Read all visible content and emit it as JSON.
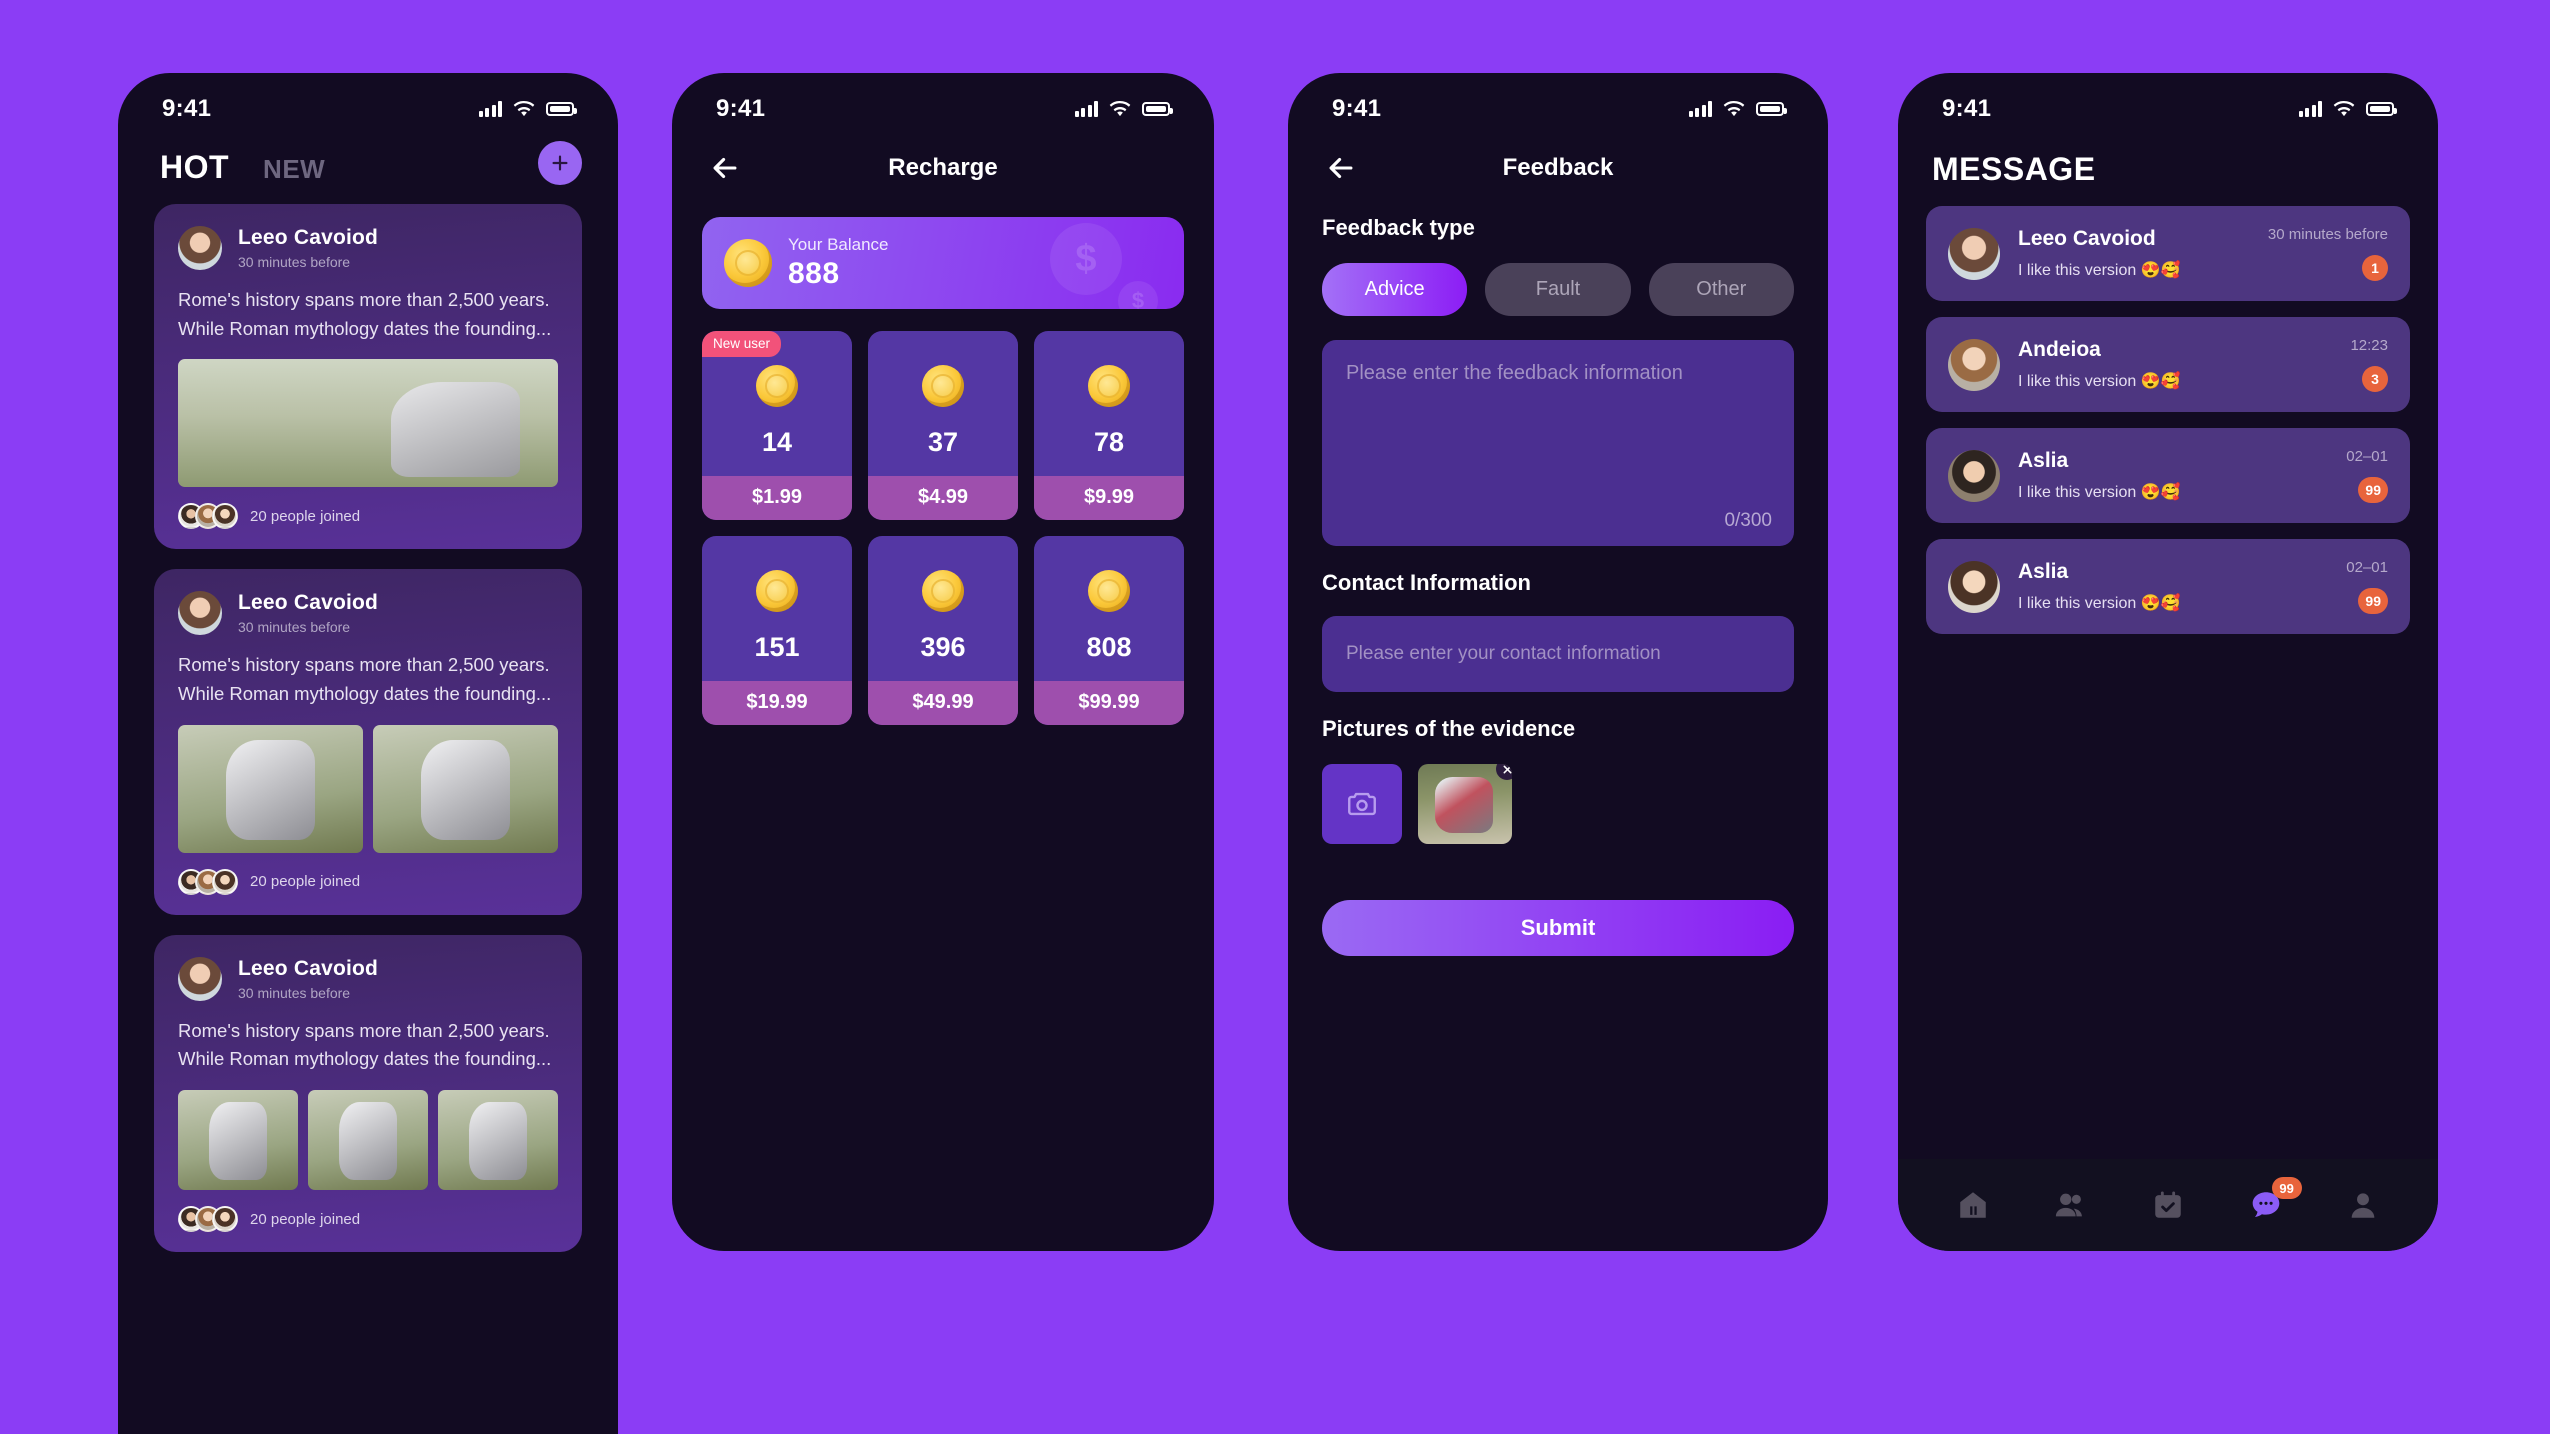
{
  "status_bar": {
    "time": "9:41",
    "signal_icon": "cellular-bars-icon",
    "wifi_icon": "wifi-icon",
    "battery_icon": "battery-icon"
  },
  "screen_feed": {
    "tabs": [
      {
        "label": "HOT",
        "active": true
      },
      {
        "label": "NEW",
        "active": false
      }
    ],
    "add_button_icon": "plus-icon",
    "posts": [
      {
        "author": "Leeo Cavoiod",
        "time": "30 minutes before",
        "text": "Rome's history spans more than 2,500 years. While Roman mythology dates the founding...",
        "media_count": 1,
        "joined_label": "20 people joined"
      },
      {
        "author": "Leeo Cavoiod",
        "time": "30 minutes before",
        "text": "Rome's history spans more than 2,500 years. While Roman mythology dates the founding...",
        "media_count": 2,
        "joined_label": "20 people joined"
      },
      {
        "author": "Leeo Cavoiod",
        "time": "30 minutes before",
        "text": "Rome's history spans more than 2,500 years. While Roman mythology dates the founding...",
        "media_count": 3,
        "joined_label": "20 people joined"
      }
    ]
  },
  "screen_recharge": {
    "title": "Recharge",
    "back_icon": "back-arrow-icon",
    "balance": {
      "label": "Your Balance",
      "amount": "888",
      "coin_icon": "coin-icon",
      "watermark": "$"
    },
    "packages": [
      {
        "coins": "14",
        "price": "$1.99",
        "badge": "New user"
      },
      {
        "coins": "37",
        "price": "$4.99",
        "badge": ""
      },
      {
        "coins": "78",
        "price": "$9.99",
        "badge": ""
      },
      {
        "coins": "151",
        "price": "$19.99",
        "badge": ""
      },
      {
        "coins": "396",
        "price": "$49.99",
        "badge": ""
      },
      {
        "coins": "808",
        "price": "$99.99",
        "badge": ""
      }
    ]
  },
  "screen_feedback": {
    "title": "Feedback",
    "back_icon": "back-arrow-icon",
    "type_label": "Feedback type",
    "types": [
      {
        "label": "Advice",
        "selected": true
      },
      {
        "label": "Fault",
        "selected": false
      },
      {
        "label": "Other",
        "selected": false
      }
    ],
    "textarea": {
      "placeholder": "Please enter the feedback information",
      "value": "",
      "counter": "0/300"
    },
    "contact_label": "Contact Information",
    "contact_input": {
      "placeholder": "Please enter your contact information",
      "value": ""
    },
    "pictures_label": "Pictures of the evidence",
    "add_photo_icon": "camera-icon",
    "remove_photo_icon": "close-icon",
    "submit_label": "Submit"
  },
  "screen_message": {
    "title": "MESSAGE",
    "conversations": [
      {
        "name": "Leeo Cavoiod",
        "preview": "I like this version 😍🥰",
        "time": "30 minutes before",
        "badge": "1"
      },
      {
        "name": "Andeioa",
        "preview": "I like this version 😍🥰",
        "time": "12:23",
        "badge": "3"
      },
      {
        "name": "Aslia",
        "preview": "I like this version 😍🥰",
        "time": "02–01",
        "badge": "99"
      },
      {
        "name": "Aslia",
        "preview": "I like this version 😍🥰",
        "time": "02–01",
        "badge": "99"
      }
    ],
    "tabbar": [
      {
        "icon": "home-icon",
        "active": false,
        "badge": ""
      },
      {
        "icon": "friends-icon",
        "active": false,
        "badge": ""
      },
      {
        "icon": "calendar-check-icon",
        "active": false,
        "badge": ""
      },
      {
        "icon": "chat-icon",
        "active": true,
        "badge": "99"
      },
      {
        "icon": "profile-icon",
        "active": false,
        "badge": ""
      }
    ]
  },
  "colors": {
    "page_background": "#8B3DF5",
    "phone_background": "#120B22",
    "accent": "#8B5CF6",
    "badge": "#E8643C",
    "new_user": "#F2527A"
  }
}
